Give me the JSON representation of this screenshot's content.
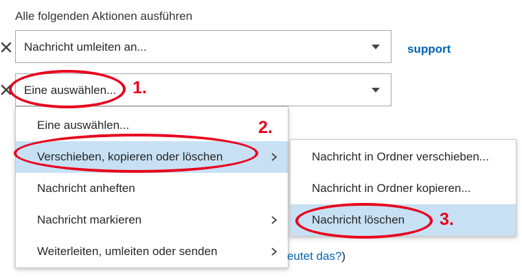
{
  "section": {
    "heading": "Alle folgenden Aktionen ausführen"
  },
  "actions": [
    {
      "value": "Nachricht umleiten an...",
      "remove_icon": "close-icon",
      "dropdown_icon": "caret-down-icon"
    },
    {
      "value": "Eine auswählen...",
      "remove_icon": "close-icon",
      "dropdown_icon": "caret-down-icon"
    }
  ],
  "support_link": "support",
  "menu": {
    "items": [
      {
        "label": "Eine auswählen...",
        "submenu": false,
        "selected": false
      },
      {
        "label": "Verschieben, kopieren oder löschen",
        "submenu": true,
        "selected": true
      },
      {
        "label": "Nachricht anheften",
        "submenu": false,
        "selected": false
      },
      {
        "label": "Nachricht markieren",
        "submenu": true,
        "selected": false
      },
      {
        "label": "Weiterleiten, umleiten oder senden",
        "submenu": true,
        "selected": false
      }
    ]
  },
  "submenu": {
    "items": [
      {
        "label": "Nachricht in Ordner verschieben...",
        "selected": false
      },
      {
        "label": "Nachricht in Ordner kopieren...",
        "selected": false
      },
      {
        "label": "Nachricht löschen",
        "selected": true
      }
    ]
  },
  "bottom_text": {
    "link": "eutet das?",
    "suffix": ")"
  },
  "annotations": {
    "step1": "1.",
    "step2": "2.",
    "step3": "3."
  },
  "colors": {
    "link": "#0063b1",
    "selected_bg": "#c7e0f4",
    "annotation": "#e8001c"
  }
}
